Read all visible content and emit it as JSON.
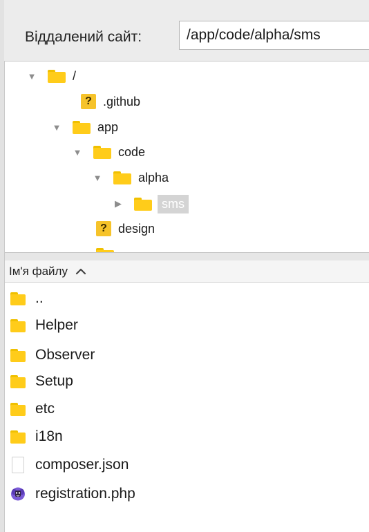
{
  "remote_site": {
    "label": "Віддалений сайт:",
    "path": "/app/code/alpha/sms"
  },
  "tree": {
    "items": [
      {
        "label": "/",
        "icon": "folder-icon",
        "state": "expanded"
      },
      {
        "label": ".github",
        "icon": "unknown-icon",
        "state": "none"
      },
      {
        "label": "app",
        "icon": "folder-icon",
        "state": "expanded"
      },
      {
        "label": "code",
        "icon": "folder-icon",
        "state": "expanded"
      },
      {
        "label": "alpha",
        "icon": "folder-icon",
        "state": "expanded"
      },
      {
        "label": "sms",
        "icon": "folder-icon",
        "state": "collapsed",
        "selected": true
      },
      {
        "label": "design",
        "icon": "unknown-icon",
        "state": "none"
      }
    ]
  },
  "file_list": {
    "column_header": "Ім'я файлу",
    "sort": "ascending",
    "files": [
      {
        "name": "..",
        "icon": "folder-icon"
      },
      {
        "name": "Helper",
        "icon": "folder-icon"
      },
      {
        "name": "Observer",
        "icon": "folder-icon"
      },
      {
        "name": "Setup",
        "icon": "folder-icon"
      },
      {
        "name": "etc",
        "icon": "folder-icon"
      },
      {
        "name": "i18n",
        "icon": "folder-icon"
      },
      {
        "name": "composer.json",
        "icon": "document-icon"
      },
      {
        "name": "registration.php",
        "icon": "php-elephant-icon"
      }
    ]
  },
  "colors": {
    "folder": "#ffcc1a",
    "unknown_badge": "#f6c32a",
    "selection": "#d4d4d4",
    "bar_background": "#ececec"
  }
}
